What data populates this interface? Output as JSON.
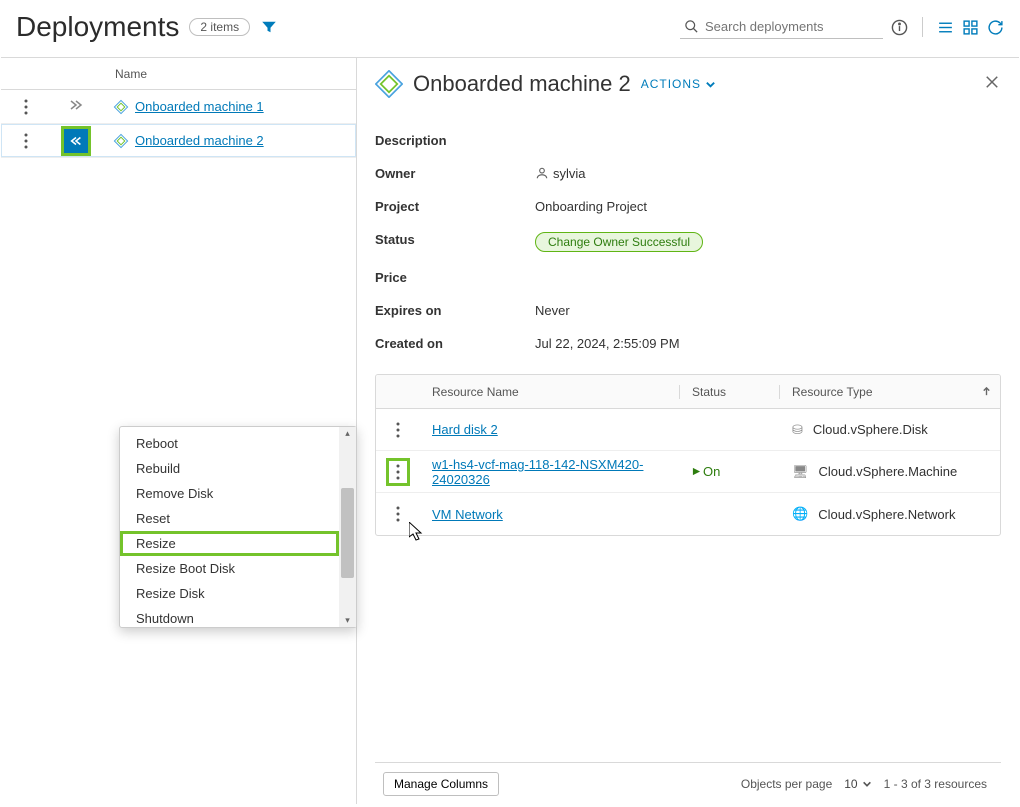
{
  "header": {
    "title": "Deployments",
    "item_count": "2 items",
    "search_placeholder": "Search deployments"
  },
  "deployments": {
    "col_label": "Name",
    "rows": [
      {
        "name": "Onboarded machine 1"
      },
      {
        "name": "Onboarded machine 2"
      }
    ]
  },
  "detail": {
    "title": "Onboarded machine 2",
    "actions_label": "ACTIONS",
    "labels": {
      "description": "Description",
      "owner": "Owner",
      "project": "Project",
      "status": "Status",
      "price": "Price",
      "expires": "Expires on",
      "created": "Created on"
    },
    "values": {
      "owner": "sylvia",
      "project": "Onboarding Project",
      "status": "Change Owner Successful",
      "expires": "Never",
      "created": "Jul 22, 2024, 2:55:09 PM"
    }
  },
  "resources": {
    "columns": {
      "name": "Resource Name",
      "status": "Status",
      "type": "Resource Type"
    },
    "rows": [
      {
        "name": "Hard disk 2",
        "status": "",
        "type": "Cloud.vSphere.Disk"
      },
      {
        "name": "w1-hs4-vcf-mag-118-142-NSXM420-24020326",
        "status": "On",
        "type": "Cloud.vSphere.Machine"
      },
      {
        "name": "VM Network",
        "status": "",
        "type": "Cloud.vSphere.Network"
      }
    ]
  },
  "footer": {
    "manage_columns": "Manage Columns",
    "objects_label": "Objects per page",
    "per_page": "10",
    "range": "1 - 3 of 3 resources"
  },
  "context_menu": {
    "items": [
      "Reboot",
      "Rebuild",
      "Remove Disk",
      "Reset",
      "Resize",
      "Resize Boot Disk",
      "Resize Disk",
      "Shutdown"
    ]
  }
}
